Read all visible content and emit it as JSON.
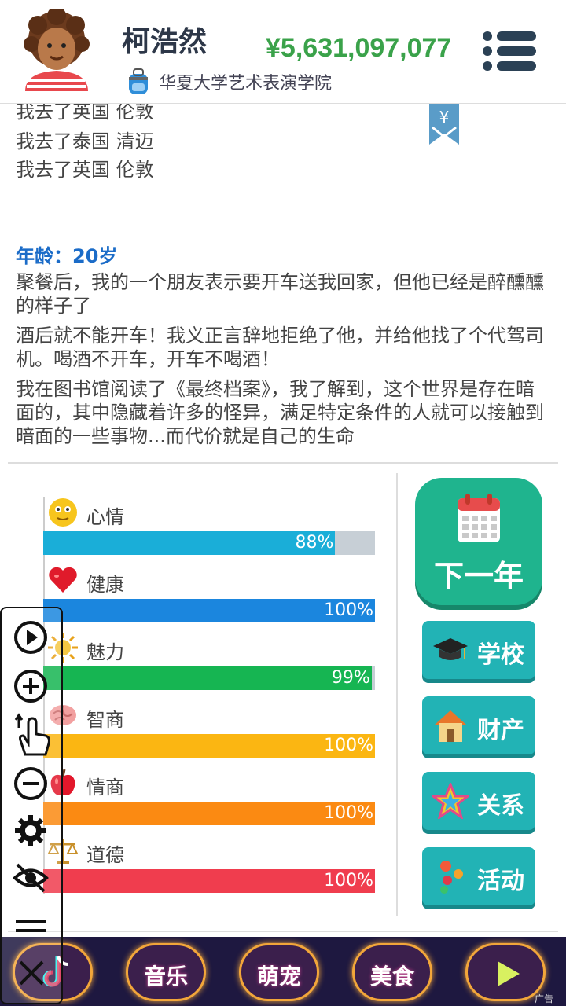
{
  "header": {
    "name": "柯浩然",
    "money": "¥5,631,097,077",
    "school": "华夏大学艺术表演学院",
    "menu_icon": "hamburger-menu-icon"
  },
  "log": {
    "lines": [
      "我去了英国 伦敦",
      "我去了泰国 清迈",
      "我去了英国 伦敦"
    ],
    "bookmark_symbol": "¥",
    "age_label": "年龄：20岁",
    "paragraphs": [
      "聚餐后，我的一个朋友表示要开车送我回家，但他已经是醉醺醺的样子了",
      "酒后就不能开车！我义正言辞地拒绝了他，并给他找了个代驾司机。喝酒不开车，开车不喝酒！",
      "我在图书馆阅读了《最终档案》，我了解到，这个世界是存在暗面的，其中隐藏着许多的怪异，满足特定条件的人就可以接触到暗面的一些事物...而代价就是自己的生命"
    ]
  },
  "stats": [
    {
      "label": "心情",
      "value": 88,
      "value_text": "88%",
      "color": "#1aaed8",
      "icon": "smiley-icon"
    },
    {
      "label": "健康",
      "value": 100,
      "value_text": "100%",
      "color": "#1b86de",
      "icon": "heart-icon"
    },
    {
      "label": "魅力",
      "value": 99,
      "value_text": "99%",
      "color": "#16b552",
      "icon": "sun-icon"
    },
    {
      "label": "智商",
      "value": 100,
      "value_text": "100%",
      "color": "#fbb612",
      "icon": "brain-icon"
    },
    {
      "label": "情商",
      "value": 100,
      "value_text": "100%",
      "color": "#fb8a12",
      "icon": "apple-icon"
    },
    {
      "label": "道德",
      "value": 100,
      "value_text": "100%",
      "color": "#f03d4e",
      "icon": "scales-icon"
    }
  ],
  "actions": {
    "next_year": "下一年",
    "school": "学校",
    "property": "财产",
    "relations": "关系",
    "activities": "活动"
  },
  "adbar": {
    "pills": [
      "音乐",
      "萌宠",
      "美食"
    ],
    "ad_tag": "广告"
  }
}
